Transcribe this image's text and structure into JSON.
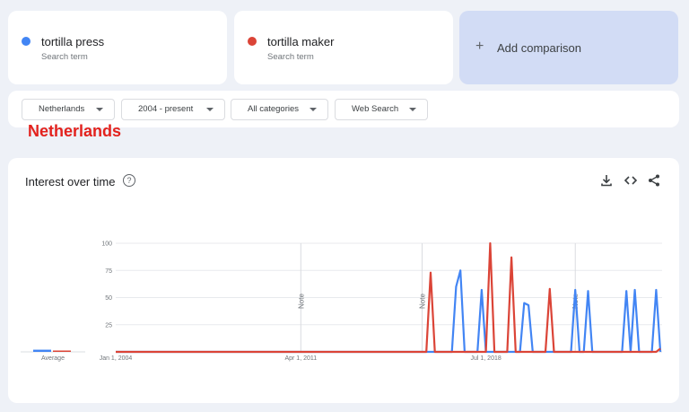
{
  "terms": [
    {
      "name": "tortilla press",
      "subtitle": "Search term",
      "color": "#4285f4"
    },
    {
      "name": "tortilla maker",
      "subtitle": "Search term",
      "color": "#db4437"
    }
  ],
  "add_comparison": {
    "icon": "plus-icon",
    "label": "Add comparison"
  },
  "filters": {
    "region": "Netherlands",
    "time_range": "2004 - present",
    "category": "All categories",
    "search_type": "Web Search"
  },
  "overlay_label": "Netherlands",
  "panel": {
    "title": "Interest over time",
    "help_glyph": "?",
    "icons": [
      "help-icon",
      "download-icon",
      "embed-icon",
      "share-icon"
    ]
  },
  "chart_data": {
    "type": "line",
    "y_ticks": [
      25,
      50,
      75,
      100
    ],
    "ylim": [
      0,
      100
    ],
    "x_tick_labels": [
      "Jan 1, 2004",
      "Apr 1, 2011",
      "Jul 1, 2018"
    ],
    "note_label": "Note",
    "note_dates": [
      "2011-04",
      "2016-01",
      "2022-01"
    ],
    "average_label": "Average",
    "average": [
      {
        "series": "tortilla press",
        "value": 2
      },
      {
        "series": "tortilla maker",
        "value": 1
      }
    ],
    "series": [
      {
        "name": "tortilla press",
        "color": "#4285f4",
        "points": [
          [
            "2004-01",
            0
          ],
          [
            "2017-03",
            0
          ],
          [
            "2017-05",
            60
          ],
          [
            "2017-07",
            75
          ],
          [
            "2017-09",
            0
          ],
          [
            "2018-03",
            0
          ],
          [
            "2018-05",
            57
          ],
          [
            "2018-07",
            0
          ],
          [
            "2019-11",
            0
          ],
          [
            "2020-01",
            45
          ],
          [
            "2020-03",
            43
          ],
          [
            "2020-05",
            0
          ],
          [
            "2021-11",
            0
          ],
          [
            "2022-01",
            57
          ],
          [
            "2022-03",
            0
          ],
          [
            "2022-05",
            0
          ],
          [
            "2022-07",
            56
          ],
          [
            "2022-09",
            0
          ],
          [
            "2023-11",
            0
          ],
          [
            "2024-01",
            56
          ],
          [
            "2024-03",
            0
          ],
          [
            "2024-05",
            57
          ],
          [
            "2024-07",
            0
          ],
          [
            "2025-01",
            0
          ],
          [
            "2025-03",
            57
          ],
          [
            "2025-05",
            0
          ]
        ]
      },
      {
        "name": "tortilla maker",
        "color": "#db4437",
        "points": [
          [
            "2004-01",
            0
          ],
          [
            "2016-03",
            0
          ],
          [
            "2016-05",
            73
          ],
          [
            "2016-07",
            0
          ],
          [
            "2018-07",
            0
          ],
          [
            "2018-09",
            100
          ],
          [
            "2018-11",
            0
          ],
          [
            "2019-05",
            0
          ],
          [
            "2019-07",
            87
          ],
          [
            "2019-09",
            0
          ],
          [
            "2020-11",
            0
          ],
          [
            "2021-01",
            58
          ],
          [
            "2021-03",
            0
          ],
          [
            "2025-03",
            0
          ],
          [
            "2025-05",
            3
          ]
        ]
      }
    ]
  }
}
